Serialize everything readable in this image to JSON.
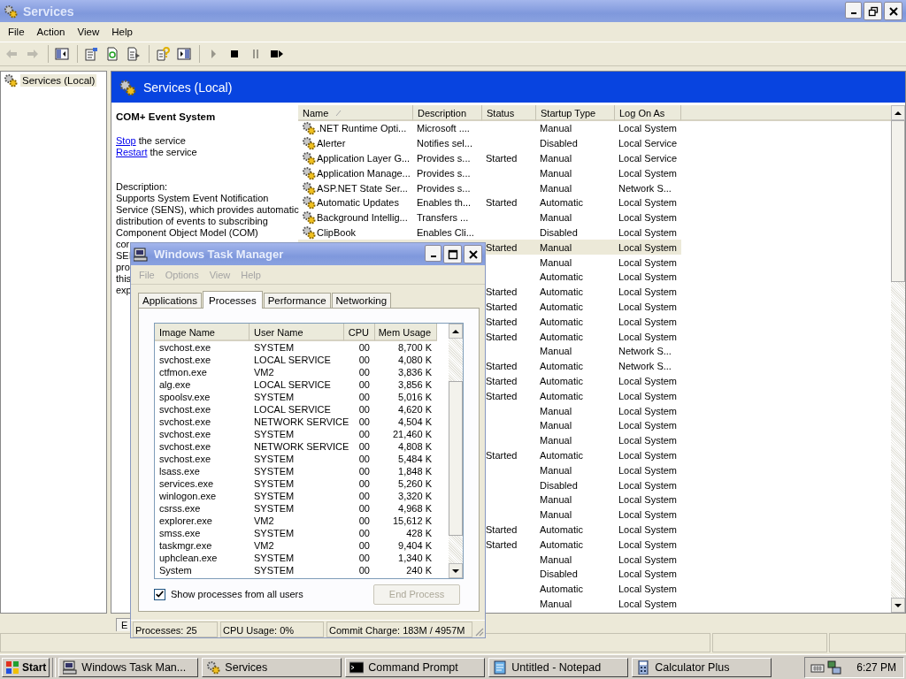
{
  "window": {
    "title": "Services"
  },
  "menu": [
    "File",
    "Action",
    "View",
    "Help"
  ],
  "toolbar": [
    [
      {
        "kind": "back",
        "disabled": true
      },
      {
        "kind": "forward",
        "disabled": true
      }
    ],
    [
      {
        "kind": "tree",
        "disabled": false
      }
    ],
    [
      {
        "kind": "properties",
        "disabled": false
      },
      {
        "kind": "refresh",
        "disabled": false
      },
      {
        "kind": "export",
        "disabled": false
      }
    ],
    [
      {
        "kind": "help",
        "disabled": false
      },
      {
        "kind": "pane",
        "disabled": false
      }
    ],
    [
      {
        "kind": "play",
        "disabled": true
      },
      {
        "kind": "stop",
        "disabled": false
      },
      {
        "kind": "pause",
        "disabled": true
      },
      {
        "kind": "restart",
        "disabled": false
      }
    ]
  ],
  "tree": [
    {
      "label": "Services (Local)"
    }
  ],
  "header": {
    "title": "Services (Local)"
  },
  "details": {
    "service_name": "COM+ Event System",
    "actions": [
      {
        "link": "Stop",
        "text": "the service"
      },
      {
        "link": "Restart",
        "text": "the service"
      }
    ],
    "description_label": "Description:",
    "description_lines": [
      "Supports System Event Notification",
      "Service (SENS), which provides automatic",
      "distribution of events to subscribing",
      "Component Object Model (COM)",
      "cor",
      "SEI",
      "pro",
      "this",
      "exp"
    ]
  },
  "table": {
    "columns": [
      "Name",
      "Description",
      "Status",
      "Startup Type",
      "Log On As"
    ],
    "rows": [
      {
        "name": ".NET Runtime Opti...",
        "description": "Microsoft ....",
        "startup_type": "Manual",
        "log_on_as": "Local System",
        "selected": false
      },
      {
        "name": "Alerter",
        "description": "Notifies sel...",
        "startup_type": "Disabled",
        "log_on_as": "Local Service",
        "selected": false
      },
      {
        "name": "Application Layer G...",
        "description": "Provides s...",
        "status": "Started",
        "startup_type": "Manual",
        "log_on_as": "Local Service",
        "selected": false
      },
      {
        "name": "Application Manage...",
        "description": "Provides s...",
        "startup_type": "Manual",
        "log_on_as": "Local System",
        "selected": false
      },
      {
        "name": "ASP.NET State Ser...",
        "description": "Provides s...",
        "startup_type": "Manual",
        "log_on_as": "Network S...",
        "selected": false
      },
      {
        "name": "Automatic Updates",
        "description": "Enables th...",
        "status": "Started",
        "startup_type": "Automatic",
        "log_on_as": "Local System",
        "selected": false
      },
      {
        "name": "Background Intellig...",
        "description": "Transfers ...",
        "startup_type": "Manual",
        "log_on_as": "Local System",
        "selected": false
      },
      {
        "name": "ClipBook",
        "description": "Enables Cli...",
        "startup_type": "Disabled",
        "log_on_as": "Local System",
        "selected": false
      },
      {
        "status": "Started",
        "startup_type": "Manual",
        "log_on_as": "Local System",
        "selected": true
      },
      {
        "startup_type": "Manual",
        "log_on_as": "Local System",
        "selected": false
      },
      {
        "startup_type": "Automatic",
        "log_on_as": "Local System",
        "selected": false
      },
      {
        "status": "Started",
        "startup_type": "Automatic",
        "log_on_as": "Local System",
        "selected": false
      },
      {
        "status": "Started",
        "startup_type": "Automatic",
        "log_on_as": "Local System",
        "selected": false
      },
      {
        "status": "Started",
        "startup_type": "Automatic",
        "log_on_as": "Local System",
        "selected": false
      },
      {
        "status": "Started",
        "startup_type": "Automatic",
        "log_on_as": "Local System",
        "selected": false
      },
      {
        "startup_type": "Manual",
        "log_on_as": "Network S...",
        "selected": false
      },
      {
        "status": "Started",
        "startup_type": "Automatic",
        "log_on_as": "Network S...",
        "selected": false
      },
      {
        "status": "Started",
        "startup_type": "Automatic",
        "log_on_as": "Local System",
        "selected": false
      },
      {
        "status": "Started",
        "startup_type": "Automatic",
        "log_on_as": "Local System",
        "selected": false
      },
      {
        "startup_type": "Manual",
        "log_on_as": "Local System",
        "selected": false
      },
      {
        "startup_type": "Manual",
        "log_on_as": "Local System",
        "selected": false
      },
      {
        "startup_type": "Manual",
        "log_on_as": "Local System",
        "selected": false
      },
      {
        "status": "Started",
        "startup_type": "Automatic",
        "log_on_as": "Local System",
        "selected": false
      },
      {
        "startup_type": "Manual",
        "log_on_as": "Local System",
        "selected": false
      },
      {
        "startup_type": "Disabled",
        "log_on_as": "Local System",
        "selected": false
      },
      {
        "startup_type": "Manual",
        "log_on_as": "Local System",
        "selected": false
      },
      {
        "startup_type": "Manual",
        "log_on_as": "Local System",
        "selected": false
      },
      {
        "status": "Started",
        "startup_type": "Automatic",
        "log_on_as": "Local System",
        "selected": false
      },
      {
        "status": "Started",
        "startup_type": "Automatic",
        "log_on_as": "Local System",
        "selected": false
      },
      {
        "startup_type": "Manual",
        "log_on_as": "Local System",
        "selected": false
      },
      {
        "startup_type": "Disabled",
        "log_on_as": "Local System",
        "selected": false
      },
      {
        "startup_type": "Automatic",
        "log_on_as": "Local System",
        "selected": false
      },
      {
        "startup_type": "Manual",
        "log_on_as": "Local System",
        "selected": false
      }
    ]
  },
  "bottom_tabs": [
    "E"
  ],
  "task_manager": {
    "title": "Windows Task Manager",
    "menu": [
      {
        "label": "File",
        "disabled": true
      },
      {
        "label": "Options",
        "disabled": true
      },
      {
        "label": "View",
        "disabled": true
      },
      {
        "label": "Help",
        "disabled": true
      }
    ],
    "tabs": [
      {
        "label": "Applications",
        "selected": false
      },
      {
        "label": "Processes",
        "selected": true
      },
      {
        "label": "Performance",
        "selected": false
      },
      {
        "label": "Networking",
        "selected": false
      }
    ],
    "columns": [
      "Image Name",
      "User Name",
      "CPU",
      "Mem Usage"
    ],
    "rows": [
      [
        "svchost.exe",
        "SYSTEM",
        "00",
        "8,700 K"
      ],
      [
        "svchost.exe",
        "LOCAL SERVICE",
        "00",
        "4,080 K"
      ],
      [
        "ctfmon.exe",
        "VM2",
        "00",
        "3,836 K"
      ],
      [
        "alg.exe",
        "LOCAL SERVICE",
        "00",
        "3,856 K"
      ],
      [
        "spoolsv.exe",
        "SYSTEM",
        "00",
        "5,016 K"
      ],
      [
        "svchost.exe",
        "LOCAL SERVICE",
        "00",
        "4,620 K"
      ],
      [
        "svchost.exe",
        "NETWORK SERVICE",
        "00",
        "4,504 K"
      ],
      [
        "svchost.exe",
        "SYSTEM",
        "00",
        "21,460 K"
      ],
      [
        "svchost.exe",
        "NETWORK SERVICE",
        "00",
        "4,808 K"
      ],
      [
        "svchost.exe",
        "SYSTEM",
        "00",
        "5,484 K"
      ],
      [
        "lsass.exe",
        "SYSTEM",
        "00",
        "1,848 K"
      ],
      [
        "services.exe",
        "SYSTEM",
        "00",
        "5,260 K"
      ],
      [
        "winlogon.exe",
        "SYSTEM",
        "00",
        "3,320 K"
      ],
      [
        "csrss.exe",
        "SYSTEM",
        "00",
        "4,968 K"
      ],
      [
        "explorer.exe",
        "VM2",
        "00",
        "15,612 K"
      ],
      [
        "smss.exe",
        "SYSTEM",
        "00",
        "428 K"
      ],
      [
        "taskmgr.exe",
        "VM2",
        "00",
        "9,404 K"
      ],
      [
        "uphclean.exe",
        "SYSTEM",
        "00",
        "1,340 K"
      ],
      [
        "System",
        "SYSTEM",
        "00",
        "240 K"
      ]
    ],
    "show_all_users": {
      "label": "Show processes from all users",
      "checked": true
    },
    "end_process": {
      "label": "End Process",
      "disabled": true
    },
    "status": [
      "Processes: 25",
      "CPU Usage: 0%",
      "Commit Charge: 183M / 4957M"
    ]
  },
  "taskbar": {
    "start": "Start",
    "tasks": [
      {
        "label": "Windows Task Man...",
        "kind": "computer",
        "selected": false
      },
      {
        "label": "Services",
        "kind": "gears",
        "selected": false
      },
      {
        "label": "Command Prompt",
        "kind": "console",
        "selected": false
      },
      {
        "label": "Untitled - Notepad",
        "kind": "notepad",
        "selected": false
      },
      {
        "label": "Calculator Plus",
        "kind": "calculator",
        "selected": false
      }
    ],
    "clock": "6:27 PM"
  }
}
